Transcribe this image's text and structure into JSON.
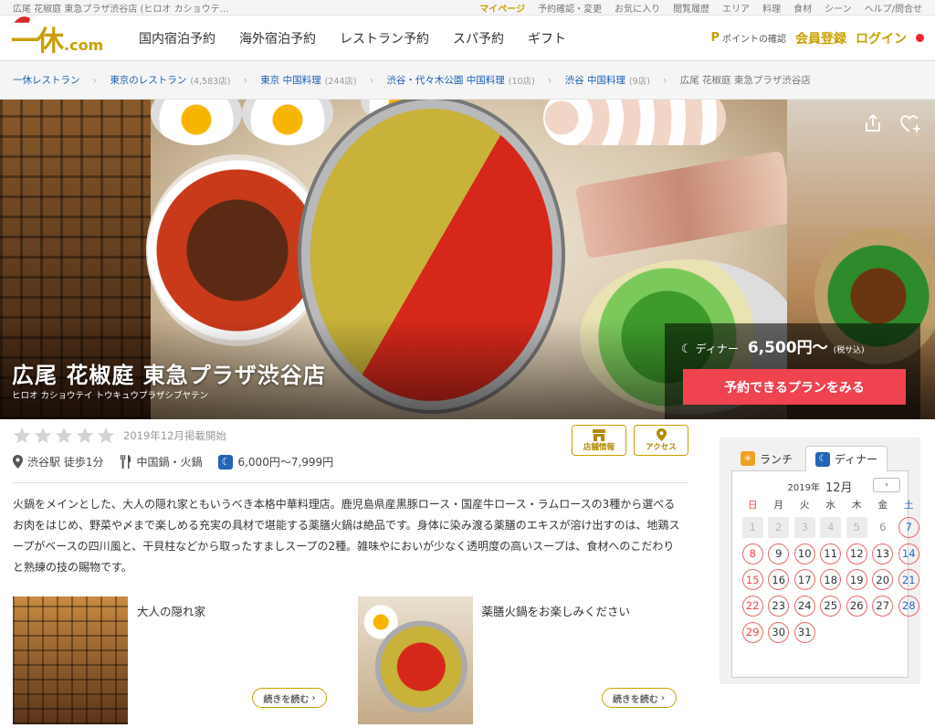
{
  "topbar": {
    "breadcrumb_title": "広尾 花椒庭 東急プラザ渋谷店 (ヒロオ カショウテ…",
    "links": [
      "マイページ",
      "予約確認・変更",
      "お気に入り",
      "閲覧履歴",
      "エリア",
      "料理",
      "食材",
      "シーン",
      "ヘルプ/問合せ"
    ]
  },
  "header": {
    "logo_kanji": "一休",
    "logo_suffix": ".com",
    "nav": [
      "国内宿泊予約",
      "海外宿泊予約",
      "レストラン予約",
      "スパ予約",
      "ギフト"
    ],
    "points_mark": "P",
    "points_label": "ポイントの確認",
    "register": "会員登録",
    "login": "ログイン"
  },
  "breadcrumb": [
    {
      "label": "一休レストラン",
      "count": ""
    },
    {
      "label": "東京のレストラン",
      "count": "(4,583店)"
    },
    {
      "label": "東京 中国料理",
      "count": "(244店)"
    },
    {
      "label": "渋谷・代々木公園 中国料理",
      "count": "(10店)"
    },
    {
      "label": "渋谷 中国料理",
      "count": "(9店)"
    },
    {
      "label": "広尾 花椒庭 東急プラザ渋谷店",
      "count": ""
    }
  ],
  "hero": {
    "title": "広尾 花椒庭 東急プラザ渋谷店",
    "kana": "ヒロオ カショウテイ トウキュウプラザシブヤテン",
    "price_label": "ディナー",
    "price": "6,500円〜",
    "tax": "(税サ込)",
    "reserve_button": "予約できるプランをみる"
  },
  "meta": {
    "rating": 0,
    "posted": "2019年12月掲載開始",
    "station": "渋谷駅 徒歩1分",
    "cuisine": "中国鍋・火鍋",
    "budget": "6,000円〜7,999円",
    "btn_info": "店舗情報",
    "btn_access": "アクセス"
  },
  "description": "火鍋をメインとした、大人の隠れ家ともいうべき本格中華料理店。鹿児島県産黒豚ロース・国産牛ロース・ラムロースの3種から選べるお肉をはじめ、野菜や〆まで楽しめる充実の具材で堪能する薬膳火鍋は絶品です。身体に染み渡る薬膳のエキスが溶け出すのは、地鶏スープがベースの四川風と、干貝柱などから取ったすましスープの2種。雑味やにおいが少なく透明度の高いスープは、食材へのこだわりと熟練の技の賜物です。",
  "cards": [
    {
      "title": "大人の隠れ家",
      "more": "続きを読む"
    },
    {
      "title": "薬膳火鍋をお楽しみください",
      "more": "続きを読む"
    }
  ],
  "calendar": {
    "tab_lunch": "ランチ",
    "tab_dinner": "ディナー",
    "year": "2019年",
    "month": "12月",
    "next": "›",
    "weekdays": [
      "日",
      "月",
      "火",
      "水",
      "木",
      "金",
      "土"
    ],
    "days": [
      {
        "d": "1",
        "s": "past"
      },
      {
        "d": "2",
        "s": "past"
      },
      {
        "d": "3",
        "s": "past"
      },
      {
        "d": "4",
        "s": "past"
      },
      {
        "d": "5",
        "s": "past"
      },
      {
        "d": "6",
        "s": "plain"
      },
      {
        "d": "7",
        "s": "avail"
      },
      {
        "d": "8",
        "s": "avail"
      },
      {
        "d": "9",
        "s": "avail"
      },
      {
        "d": "10",
        "s": "avail"
      },
      {
        "d": "11",
        "s": "avail"
      },
      {
        "d": "12",
        "s": "avail"
      },
      {
        "d": "13",
        "s": "avail"
      },
      {
        "d": "14",
        "s": "avail"
      },
      {
        "d": "15",
        "s": "avail"
      },
      {
        "d": "16",
        "s": "avail"
      },
      {
        "d": "17",
        "s": "avail"
      },
      {
        "d": "18",
        "s": "avail"
      },
      {
        "d": "19",
        "s": "avail"
      },
      {
        "d": "20",
        "s": "avail"
      },
      {
        "d": "21",
        "s": "avail"
      },
      {
        "d": "22",
        "s": "avail"
      },
      {
        "d": "23",
        "s": "avail"
      },
      {
        "d": "24",
        "s": "avail"
      },
      {
        "d": "25",
        "s": "avail"
      },
      {
        "d": "26",
        "s": "avail"
      },
      {
        "d": "27",
        "s": "avail"
      },
      {
        "d": "28",
        "s": "avail"
      },
      {
        "d": "29",
        "s": "avail"
      },
      {
        "d": "30",
        "s": "avail"
      },
      {
        "d": "31",
        "s": "avail"
      }
    ]
  },
  "colors": {
    "gold": "#c9a000",
    "reserve": "#ef4350",
    "link": "#1a5fb4",
    "avail_ring": "#e86767"
  }
}
